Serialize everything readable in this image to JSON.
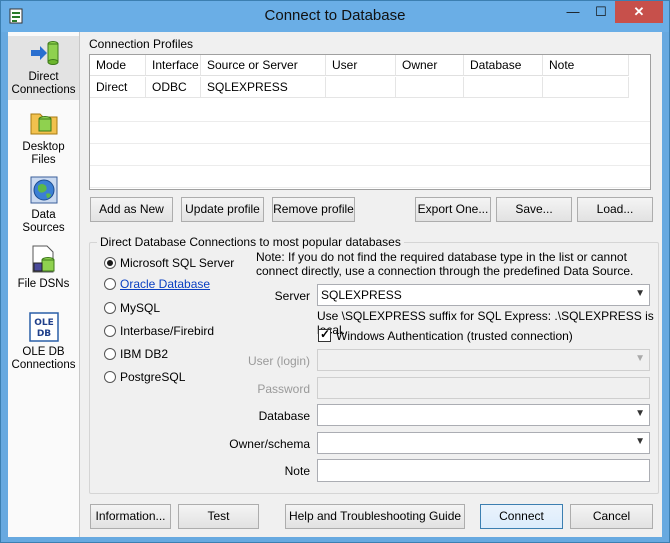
{
  "window": {
    "title": "Connect to Database",
    "min_label": "—",
    "max_label": "☐",
    "close_label": "✕"
  },
  "sidebar": {
    "items": [
      {
        "label_lines": [
          "Direct",
          "Connections"
        ],
        "icon": "direct-connections-icon"
      },
      {
        "label_lines": [
          "Desktop",
          "Files"
        ],
        "icon": "desktop-files-icon"
      },
      {
        "label_lines": [
          "Data",
          "Sources"
        ],
        "icon": "data-sources-icon"
      },
      {
        "label_lines": [
          "File DSNs"
        ],
        "icon": "file-dsns-icon"
      },
      {
        "label_lines": [
          "OLE DB",
          "Connections"
        ],
        "icon": "ole-db-icon"
      }
    ]
  },
  "profiles": {
    "title": "Connection Profiles",
    "columns": [
      "Mode",
      "Interface",
      "Source or Server",
      "User",
      "Owner",
      "Database",
      "Note"
    ],
    "rows": [
      [
        "Direct",
        "ODBC",
        "SQLEXPRESS",
        "",
        "",
        "",
        ""
      ]
    ]
  },
  "profile_buttons": {
    "add": "Add as New",
    "update": "Update profile",
    "remove": "Remove profile",
    "export": "Export One...",
    "save": "Save...",
    "load": "Load..."
  },
  "direct": {
    "group_title": "Direct Database Connections to most popular databases",
    "note": "Note: If you do not find the required database type in the list or cannot connect directly, use a connection through the predefined Data Source.",
    "db_types": [
      {
        "label": "Microsoft SQL Server",
        "selected": true,
        "link": false
      },
      {
        "label": "Oracle Database",
        "selected": false,
        "link": true
      },
      {
        "label": "MySQL",
        "selected": false,
        "link": false
      },
      {
        "label": "Interbase/Firebird",
        "selected": false,
        "link": false
      },
      {
        "label": "IBM DB2",
        "selected": false,
        "link": false
      },
      {
        "label": "PostgreSQL",
        "selected": false,
        "link": false
      }
    ],
    "server_label": "Server",
    "server_value": "SQLEXPRESS",
    "server_hint": "Use \\SQLEXPRESS suffix for SQL Express: .\\SQLEXPRESS is local.",
    "windows_auth_label": "Windows Authentication (trusted connection)",
    "windows_auth_checked": true,
    "user_label": "User (login)",
    "user_value": "",
    "password_label": "Password",
    "password_value": "",
    "database_label": "Database",
    "database_value": "",
    "owner_label": "Owner/schema",
    "owner_value": "",
    "note_label": "Note",
    "note_value": ""
  },
  "footer": {
    "information": "Information...",
    "test": "Test",
    "help": "Help and Troubleshooting Guide",
    "connect": "Connect",
    "cancel": "Cancel"
  },
  "colors": {
    "titlebar": "#6aaee6",
    "close": "#c7504b",
    "link": "#0a3fc2"
  }
}
